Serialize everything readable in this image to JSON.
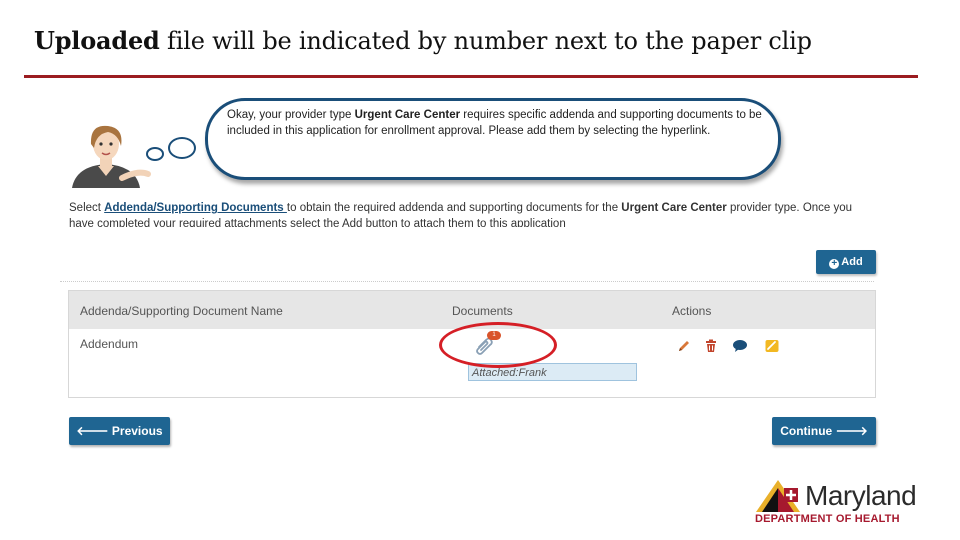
{
  "slide": {
    "title_lead": "Uploaded",
    "title_rest": " file will be indicated by number next to the paper clip"
  },
  "bubble": {
    "text_1": "Okay, your provider type ",
    "provider_type": "Urgent Care Center",
    "text_2": " requires specific addenda and supporting documents to be included in this application for enrollment approval. Please add them by selecting the hyperlink."
  },
  "instructions": {
    "text_1": "Select ",
    "link": "Addenda/Supporting Documents ",
    "text_2": "to obtain the required addenda and supporting documents for the ",
    "provider_type": "Urgent Care Center",
    "text_3": " provider type. Once you have completed your required attachments select the Add button to attach them to this application"
  },
  "buttons": {
    "add": "Add",
    "previous": "Previous",
    "continue": "Continue"
  },
  "table": {
    "columns": [
      "Addenda/Supporting Document Name",
      "Documents",
      "Actions"
    ],
    "rows": [
      {
        "name": "Addendum",
        "document_count": "1",
        "attached": "Attached:Frank"
      }
    ],
    "action_icons": [
      "edit-icon",
      "delete-icon",
      "comment-icon",
      "note-icon"
    ]
  },
  "logo": {
    "name": "Maryland",
    "department": "DEPARTMENT OF HEALTH"
  },
  "colors": {
    "title_rule": "#9b1c20",
    "button_blue": "#1f6592",
    "highlight_red": "#d51f26",
    "badge_orange": "#d9542b",
    "link_blue": "#1a4e79"
  }
}
